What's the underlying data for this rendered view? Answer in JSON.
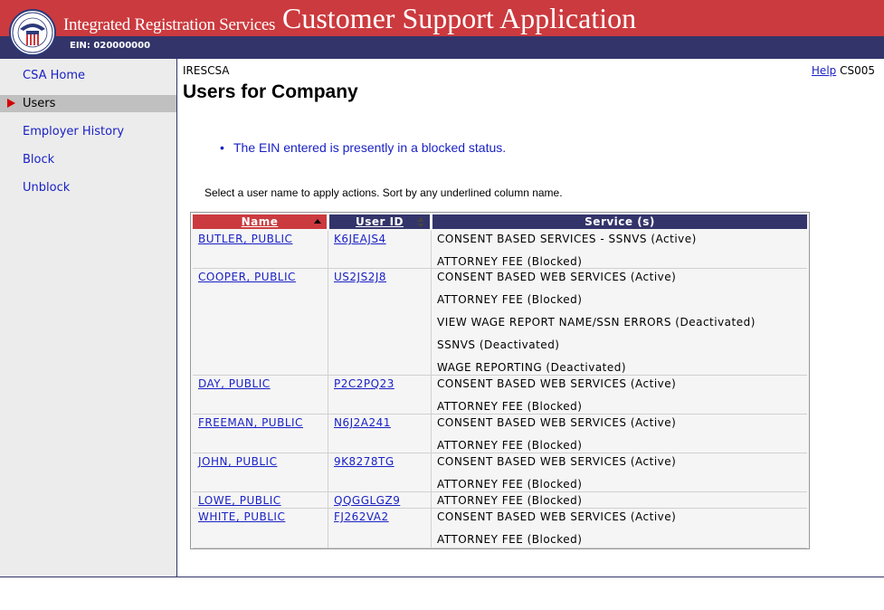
{
  "header": {
    "brand": "Integrated Registration Services",
    "app_title": "Customer Support Application",
    "ein": "EIN: 020000000",
    "colors": {
      "red": "#cb3a3e",
      "navy": "#33346a"
    }
  },
  "sidebar": {
    "items": [
      {
        "label": "CSA Home",
        "active": false
      },
      {
        "label": "Users",
        "active": true
      },
      {
        "label": "Employer History",
        "active": false
      },
      {
        "label": "Block",
        "active": false
      },
      {
        "label": "Unblock",
        "active": false
      }
    ]
  },
  "main": {
    "screen_code": "IRESCSA",
    "help_label": "Help",
    "screen_id": "CS005",
    "title": "Users for Company",
    "message": "The EIN entered is presently in a blocked status.",
    "instructions": "Select a user name to apply actions. Sort by any underlined column name."
  },
  "table": {
    "headers": {
      "name": "Name",
      "user_id": "User ID",
      "services": "Service (s)"
    },
    "rows": [
      {
        "name": "BUTLER, PUBLIC",
        "user_id": "K6JEAJS4",
        "services": [
          "CONSENT BASED SERVICES - SSNVS (Active)",
          "ATTORNEY FEE (Blocked)"
        ]
      },
      {
        "name": "COOPER, PUBLIC",
        "user_id": "US2JS2J8",
        "services": [
          "CONSENT BASED WEB SERVICES (Active)",
          "ATTORNEY FEE (Blocked)",
          "VIEW WAGE REPORT NAME/SSN ERRORS (Deactivated)",
          "SSNVS (Deactivated)",
          "WAGE REPORTING (Deactivated)"
        ]
      },
      {
        "name": "DAY, PUBLIC",
        "user_id": "P2C2PQ23",
        "services": [
          "CONSENT BASED WEB SERVICES (Active)",
          "ATTORNEY FEE (Blocked)"
        ]
      },
      {
        "name": "FREEMAN, PUBLIC",
        "user_id": "N6J2A241",
        "services": [
          "CONSENT BASED WEB SERVICES (Active)",
          "ATTORNEY FEE (Blocked)"
        ]
      },
      {
        "name": "JOHN, PUBLIC",
        "user_id": "9K8278TG",
        "services": [
          "CONSENT BASED WEB SERVICES (Active)",
          "ATTORNEY FEE (Blocked)"
        ]
      },
      {
        "name": "LOWE, PUBLIC",
        "user_id": "QQGGLGZ9",
        "services": [
          "ATTORNEY FEE (Blocked)"
        ]
      },
      {
        "name": "WHITE, PUBLIC",
        "user_id": "FJ262VA2",
        "services": [
          "CONSENT BASED WEB SERVICES (Active)",
          "ATTORNEY FEE (Blocked)"
        ]
      }
    ]
  }
}
